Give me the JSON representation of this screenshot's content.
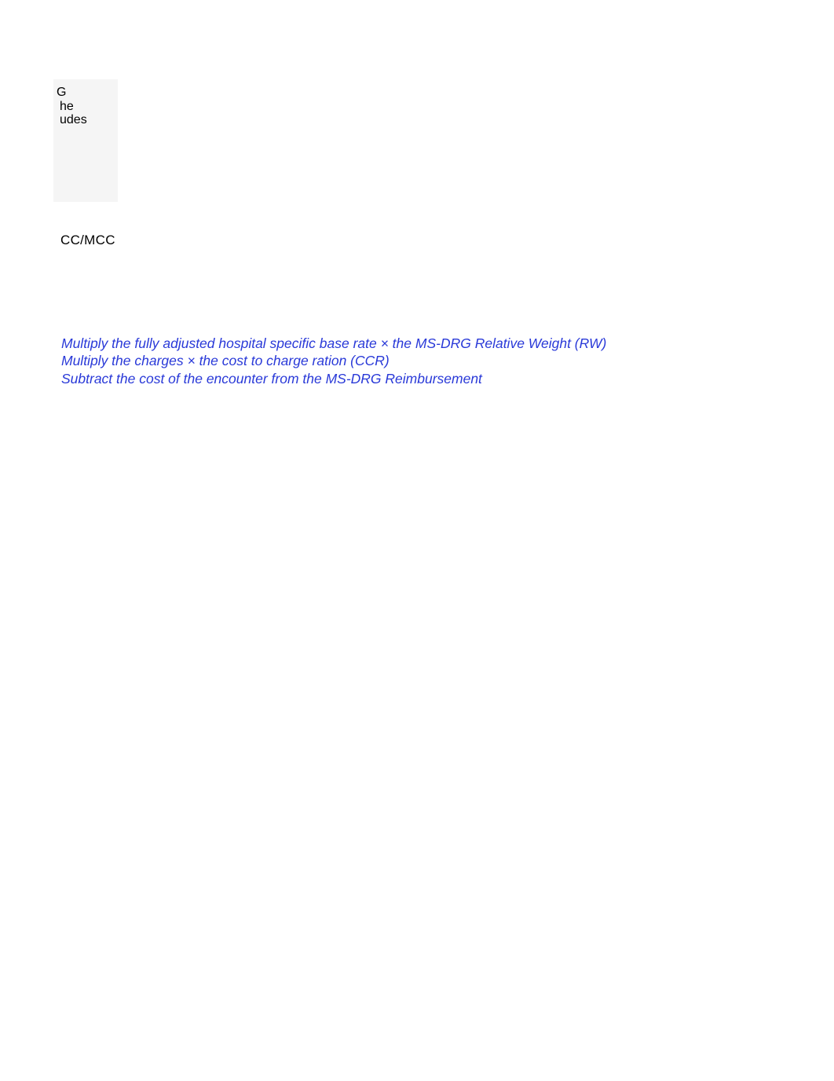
{
  "topBlock": {
    "line1": "G",
    "line2": "he",
    "line3": "udes"
  },
  "ccMcc": "CC/MCC",
  "instructions": {
    "line1": "Multiply the fully adjusted hospital specific base rate × the MS-DRG Relative Weight (RW)",
    "line2": "Multiply the charges × the cost to charge ration (CCR)",
    "line3": "Subtract the cost of the encounter from the MS-DRG Reimbursement"
  }
}
